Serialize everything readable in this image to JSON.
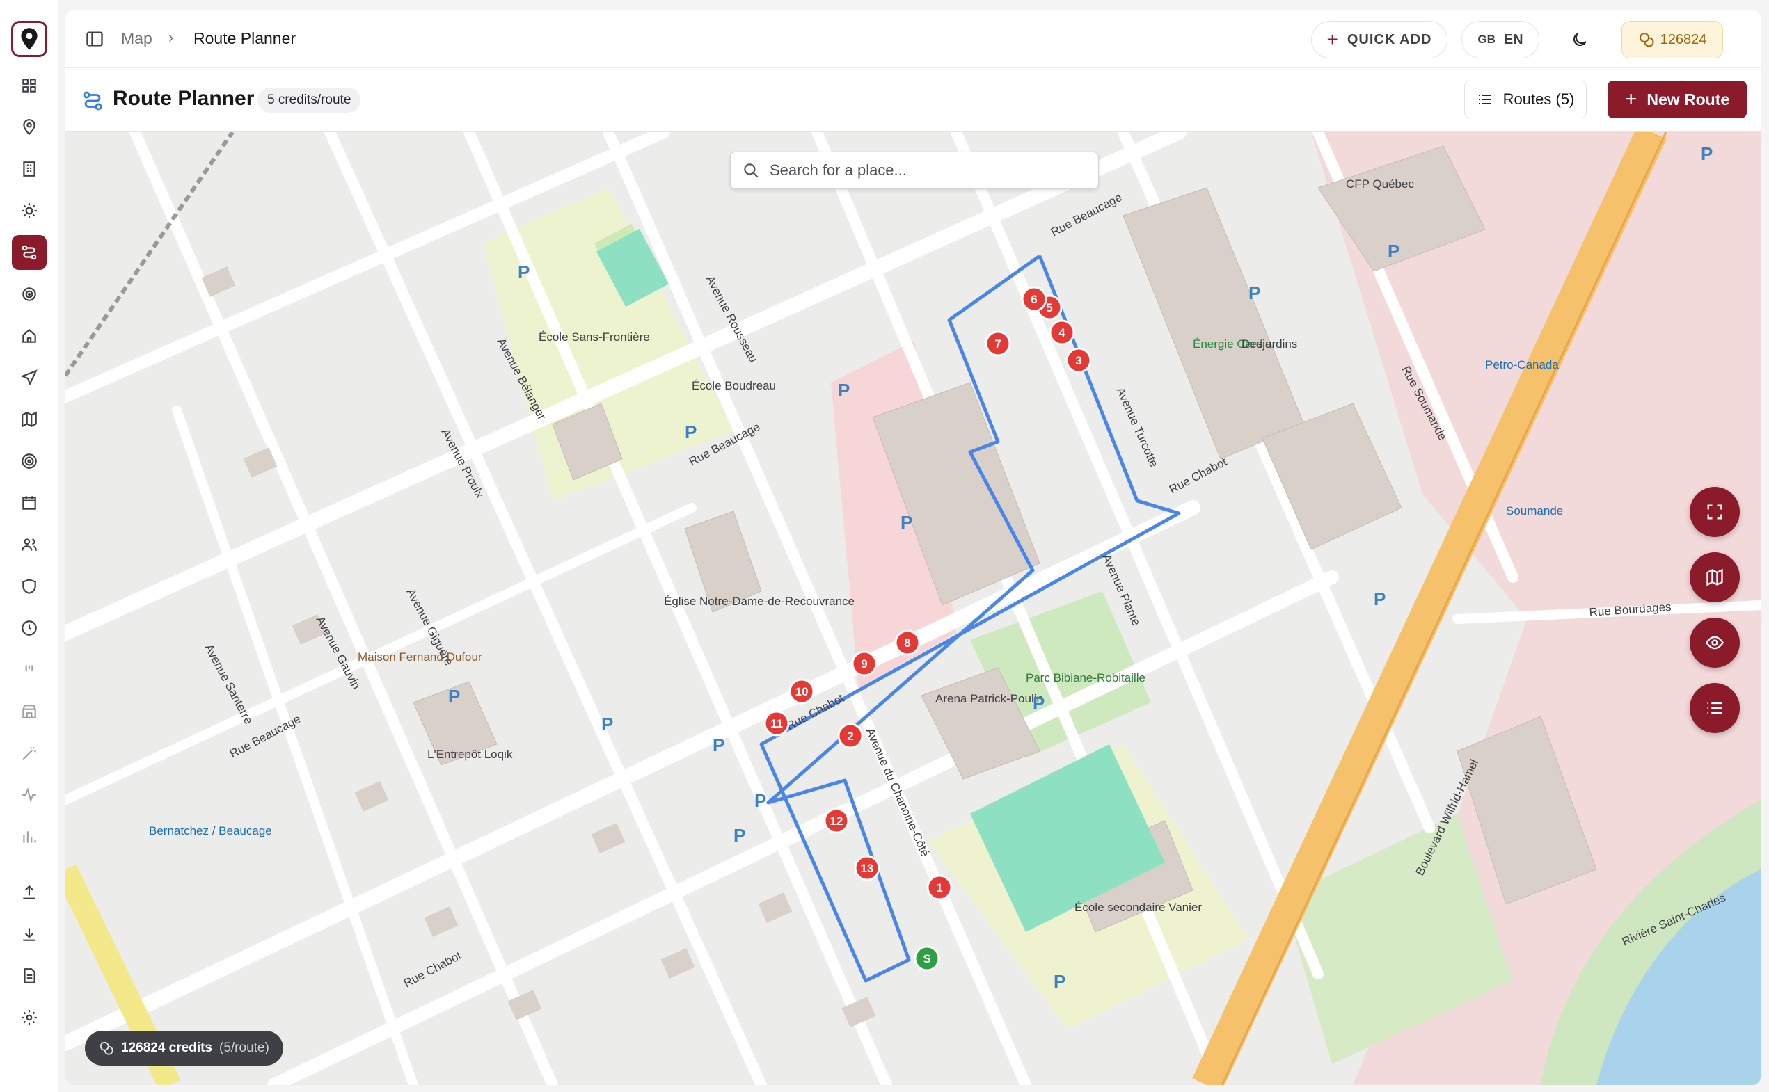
{
  "breadcrumb": {
    "root": "Map",
    "current": "Route Planner"
  },
  "topbar": {
    "quick_add": "QUICK ADD",
    "lang_flag": "GB",
    "lang": "EN",
    "credits": "126824"
  },
  "header": {
    "title": "Route Planner",
    "cost_badge": "5 credits/route",
    "routes_button": "Routes (5)",
    "new_route_button": "New Route"
  },
  "search": {
    "placeholder": "Search for a place..."
  },
  "credits_toast": {
    "amount": "126824 credits",
    "per_route": "(5/route)"
  },
  "colors": {
    "accent": "#8b1a2b",
    "route": "#4a86e8",
    "stop": "#e53935",
    "start": "#2ea043"
  },
  "map": {
    "labels": {
      "rue_beaucage_1": "Rue Beaucage",
      "rue_beaucage_2": "Rue Beaucage",
      "rue_beaucage_3": "Rue Beaucage",
      "rue_chabot_1": "Rue Chabot",
      "rue_chabot_2": "Rue Chabot",
      "rue_chabot_3": "Rue Chabot",
      "avenue_belanger": "Avenue Bélanger",
      "avenue_rousseau": "Avenue Rousseau",
      "avenue_proulx": "Avenue Proulx",
      "avenue_giguere": "Avenue Giguère",
      "avenue_gauvin": "Avenue Gauvin",
      "avenue_santerre": "Avenue Santerre",
      "avenue_plante": "Avenue Plante",
      "avenue_turcotte": "Avenue Turcotte",
      "avenue_chanoine": "Avenue du Chanoine-Côté",
      "rue_soumande": "Rue Soumande",
      "rue_bourdages": "Rue Bourdages",
      "boulevard_wh": "Boulevard Wilfrid-Hamel",
      "riviere": "Rivière Saint-Charles",
      "ecole_sans_frontiere": "École Sans-Frontière",
      "ecole_boudreau": "École Boudreau",
      "eglise": "Église Notre-Dame-de-Recouvrance",
      "arena": "Arena Patrick-Poulin",
      "parc": "Parc Bibiane-Robitaille",
      "ecole_vanier": "École secondaire Vanier",
      "energie": "Énergie Cardio",
      "desjardins": "Desjardins",
      "cfp": "CFP Québec",
      "petro": "Petro-Canada",
      "maison": "Maison Fernand Dufour",
      "entrepot": "L'Entrepôt Loqik",
      "bernatchez": "Bernatchez / Beaucage",
      "soumande_stop": "Soumande"
    },
    "stops": [
      "1",
      "2",
      "3",
      "4",
      "5",
      "6",
      "7",
      "8",
      "9",
      "10",
      "11",
      "12",
      "13"
    ],
    "start": "S"
  }
}
